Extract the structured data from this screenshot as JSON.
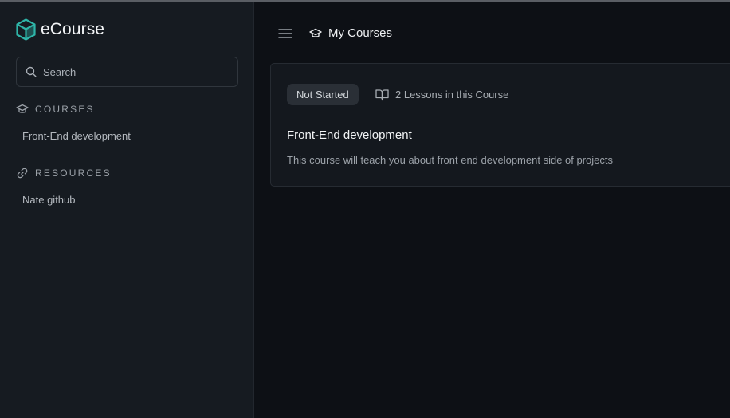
{
  "app": {
    "name": "eCourse"
  },
  "search": {
    "placeholder": "Search"
  },
  "sidebar": {
    "sections": [
      {
        "title": "COURSES",
        "icon": "graduation-cap-icon",
        "items": [
          "Front-End development"
        ]
      },
      {
        "title": "RESOURCES",
        "icon": "link-icon",
        "items": [
          "Nate github"
        ]
      }
    ]
  },
  "header": {
    "title": "My Courses"
  },
  "course_card": {
    "status": "Not Started",
    "lessons_label": "2 Lessons in this Course",
    "title": "Front-End development",
    "description": "This course will teach you about front end development side of projects"
  },
  "colors": {
    "accent": "#2fb5a8",
    "background": "#0d1015",
    "sidebar": "#161b21",
    "card": "#14181e"
  }
}
